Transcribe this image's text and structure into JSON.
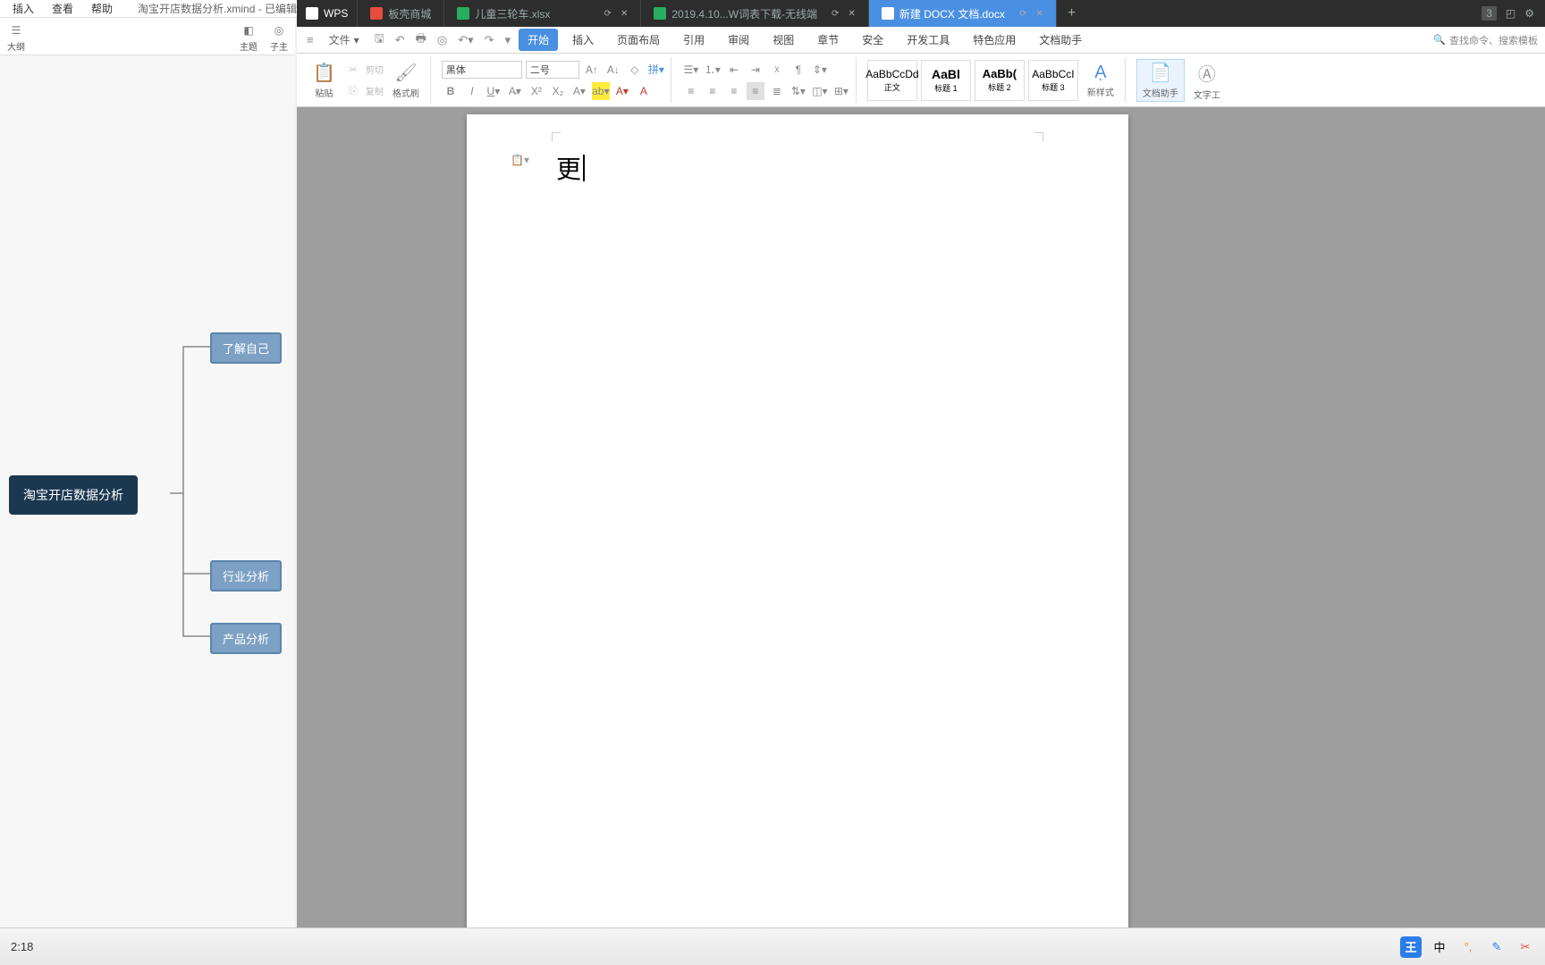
{
  "xmind": {
    "menus": [
      "",
      "插入",
      "查看",
      "帮助"
    ],
    "title": "淘宝开店数据分析.xmind - 已编辑",
    "sub_items": [
      "",
      "大纲",
      "主题",
      "子主"
    ],
    "nodes": {
      "root": "淘宝开店数据分析",
      "n1": "了解自己",
      "n2": "行业分析",
      "n3": "产品分析"
    }
  },
  "wps": {
    "tabs": {
      "home": "WPS",
      "t1": "板壳商城",
      "t2": "儿童三轮车.xlsx",
      "t3": "2019.4.10...W词表下载-无线端",
      "t4": "新建 DOCX 文档.docx"
    },
    "new_badge": "3",
    "menu": {
      "file": "文件",
      "items": [
        "开始",
        "插入",
        "页面布局",
        "引用",
        "审阅",
        "视图",
        "章节",
        "安全",
        "开发工具",
        "特色应用",
        "文档助手"
      ],
      "search": "查找命令、搜索模板"
    },
    "ribbon": {
      "paste": "粘贴",
      "cut": "剪切",
      "copy": "复制",
      "format_painter": "格式刷",
      "font_name": "黑体",
      "font_size": "二号",
      "styles": {
        "s1_preview": "AaBbCcDd",
        "s1_label": "正文",
        "s2_preview": "AaBl",
        "s2_label": "标题 1",
        "s3_preview": "AaBb(",
        "s3_label": "标题 2",
        "s4_preview": "AaBbCcI",
        "s4_label": "标题 3"
      },
      "new_style": "新样式",
      "doc_assistant": "文档助手",
      "text_tool": "文字工"
    },
    "document": {
      "text": "更"
    }
  },
  "taskbar": {
    "time": "2:18",
    "ime_badge": "王",
    "ime_lang": "中"
  }
}
